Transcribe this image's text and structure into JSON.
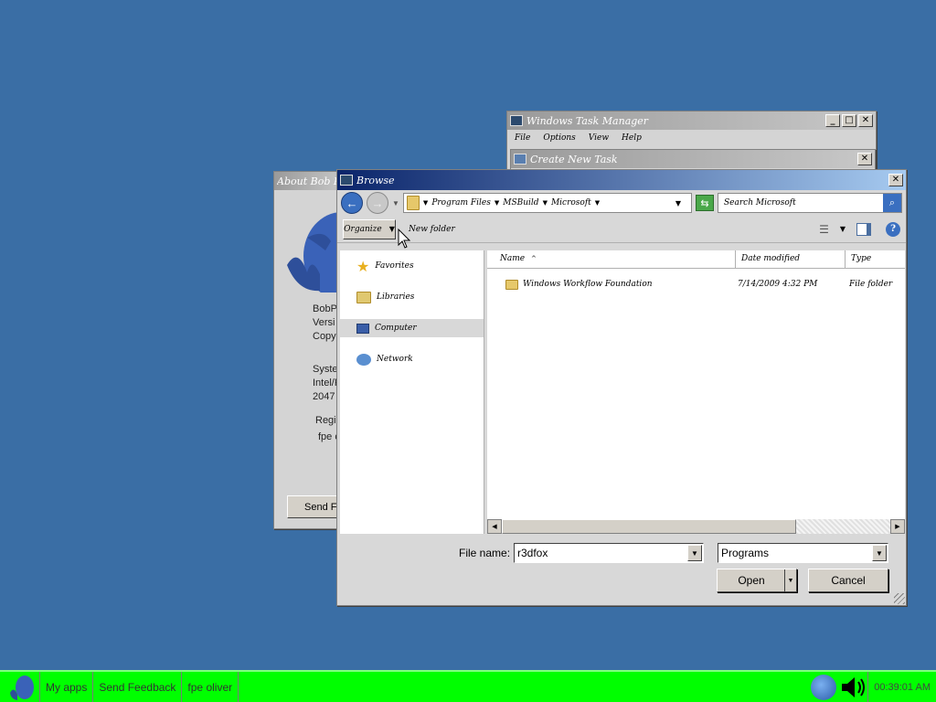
{
  "desktop": {
    "background": "#3a6ea5"
  },
  "task_manager": {
    "title": "Windows Task Manager",
    "menu": [
      "File",
      "Options",
      "View",
      "Help"
    ]
  },
  "create_task": {
    "title": "Create New Task"
  },
  "about": {
    "title": "About Bob Program",
    "lines": [
      "BobP",
      "Versi",
      "Copy",
      "Syste",
      "Intel/F",
      "2047",
      "Regi",
      "fpe c"
    ],
    "send_button": "Send Fe"
  },
  "dialog": {
    "title": "Browse",
    "address": {
      "crumbs": [
        "Program Files",
        "MSBuild",
        "Microsoft"
      ]
    },
    "search_placeholder": "Search Microsoft",
    "toolbar": {
      "organize": "Organize",
      "new_folder": "New folder"
    },
    "nav": [
      "Favorites",
      "Libraries",
      "Computer",
      "Network"
    ],
    "columns": {
      "name": "Name",
      "date": "Date modified",
      "type": "Type"
    },
    "rows": [
      {
        "name": "Windows Workflow Foundation",
        "date": "7/14/2009 4:32 PM",
        "type": "File folder"
      }
    ],
    "filename_label": "File name:",
    "filename_value": "r3dfox",
    "filter_value": "Programs",
    "open_label": "Open",
    "cancel_label": "Cancel"
  },
  "taskbar": {
    "color": "#00ff00",
    "items": [
      "My apps",
      "Send Feedback",
      "fpe oliver"
    ],
    "clock": "00:39:01 AM"
  }
}
